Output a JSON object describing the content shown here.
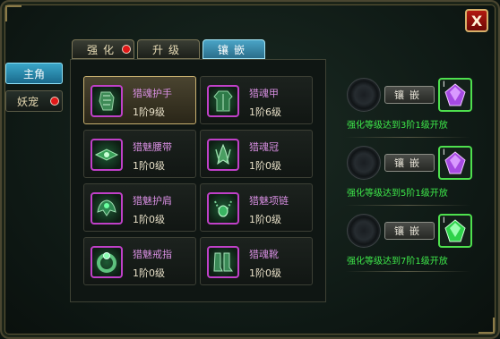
{
  "window": {
    "close_label": "X"
  },
  "side_tabs": [
    {
      "label": "主角",
      "active": true
    },
    {
      "label": "妖宠",
      "active": false,
      "has_alert": true
    }
  ],
  "top_tabs": [
    {
      "label": "强化",
      "active": false,
      "has_alert": true
    },
    {
      "label": "升级",
      "active": false
    },
    {
      "label": "镶嵌",
      "active": true
    }
  ],
  "equipment": [
    {
      "name": "猎魂护手",
      "level": "1阶9级",
      "icon": "gauntlet-icon",
      "selected": true
    },
    {
      "name": "猎魂甲",
      "level": "1阶6级",
      "icon": "armor-icon",
      "selected": false
    },
    {
      "name": "猎魅腰带",
      "level": "1阶0级",
      "icon": "belt-icon",
      "selected": false
    },
    {
      "name": "猎魂冠",
      "level": "1阶0级",
      "icon": "crown-icon",
      "selected": false
    },
    {
      "name": "猎魅护肩",
      "level": "1阶0级",
      "icon": "shoulder-icon",
      "selected": false
    },
    {
      "name": "猎魅项链",
      "level": "1阶0级",
      "icon": "necklace-icon",
      "selected": false
    },
    {
      "name": "猎魅戒指",
      "level": "1阶0级",
      "icon": "ring-icon",
      "selected": false
    },
    {
      "name": "猎魂靴",
      "level": "1阶0级",
      "icon": "boots-icon",
      "selected": false
    }
  ],
  "gem_slots": [
    {
      "button_label": "镶嵌",
      "gem_marker": "I",
      "gem_color": "#b04ae0",
      "note": "强化等级达到3阶1级开放"
    },
    {
      "button_label": "镶嵌",
      "gem_marker": "I",
      "gem_color": "#b04ae0",
      "note": "强化等级达到5阶1级开放"
    },
    {
      "button_label": "镶嵌",
      "gem_marker": "I",
      "gem_color": "#2ed24a",
      "note": "强化等级达到7阶1级开放"
    }
  ],
  "colors": {
    "accent_blue": "#3aa6c8",
    "item_name": "#d68ee0",
    "unlock_note": "#3ee84a",
    "alert_red": "#e01818"
  }
}
